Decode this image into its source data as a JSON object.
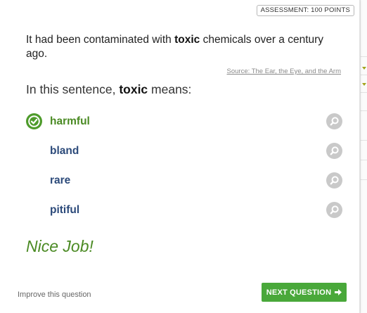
{
  "assessment": {
    "points_label": "ASSESSMENT: 100 POINTS"
  },
  "sentence": {
    "before": "It had been contaminated with ",
    "keyword": "toxic",
    "after": " chemicals over a century ago."
  },
  "source": "Source: The Ear, the Eye, and the Arm",
  "question": {
    "before": "In this sentence, ",
    "keyword": "toxic",
    "after": " means:"
  },
  "choices": [
    {
      "label": "harmful",
      "correct": true
    },
    {
      "label": "bland"
    },
    {
      "label": "rare"
    },
    {
      "label": "pitiful"
    }
  ],
  "feedback": "Nice Job!",
  "footer": {
    "improve_link": "Improve this question",
    "next_button": "NEXT QUESTION"
  },
  "colors": {
    "correct": "#4a8a23",
    "button": "#49a83a",
    "choice_text": "#2c4a7a",
    "zoom_icon_bg": "#c9c9c9"
  }
}
